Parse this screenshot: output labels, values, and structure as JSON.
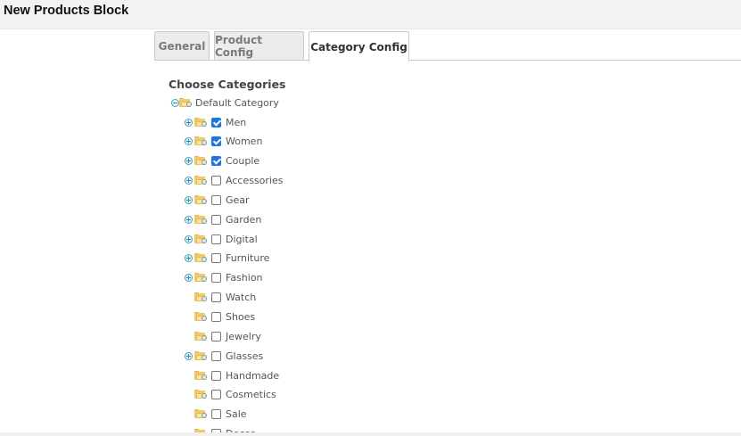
{
  "page": {
    "title": "New Products Block"
  },
  "tabs": [
    {
      "label": "General",
      "active": false
    },
    {
      "label": "Product Config",
      "active": false
    },
    {
      "label": "Category Config",
      "active": true
    }
  ],
  "section": {
    "title": "Choose Categories"
  },
  "tree": {
    "root": {
      "label": "Default Category",
      "expanded": true
    },
    "children": [
      {
        "label": "Men",
        "checked": true,
        "has_children": true
      },
      {
        "label": "Women",
        "checked": true,
        "has_children": true
      },
      {
        "label": "Couple",
        "checked": true,
        "has_children": true
      },
      {
        "label": "Accessories",
        "checked": false,
        "has_children": true
      },
      {
        "label": "Gear",
        "checked": false,
        "has_children": true
      },
      {
        "label": "Garden",
        "checked": false,
        "has_children": true
      },
      {
        "label": "Digital",
        "checked": false,
        "has_children": true
      },
      {
        "label": "Furniture",
        "checked": false,
        "has_children": true
      },
      {
        "label": "Fashion",
        "checked": false,
        "has_children": true
      },
      {
        "label": "Watch",
        "checked": false,
        "has_children": false
      },
      {
        "label": "Shoes",
        "checked": false,
        "has_children": false
      },
      {
        "label": "Jewelry",
        "checked": false,
        "has_children": false
      },
      {
        "label": "Glasses",
        "checked": false,
        "has_children": true
      },
      {
        "label": "Handmade",
        "checked": false,
        "has_children": false
      },
      {
        "label": "Cosmetics",
        "checked": false,
        "has_children": false
      },
      {
        "label": "Sale",
        "checked": false,
        "has_children": false
      },
      {
        "label": "Decor",
        "checked": false,
        "has_children": false
      }
    ]
  },
  "colors": {
    "checkbox_checked": "#1a73e8",
    "expander": "#3aa6c8",
    "folder": "#f3c963"
  }
}
